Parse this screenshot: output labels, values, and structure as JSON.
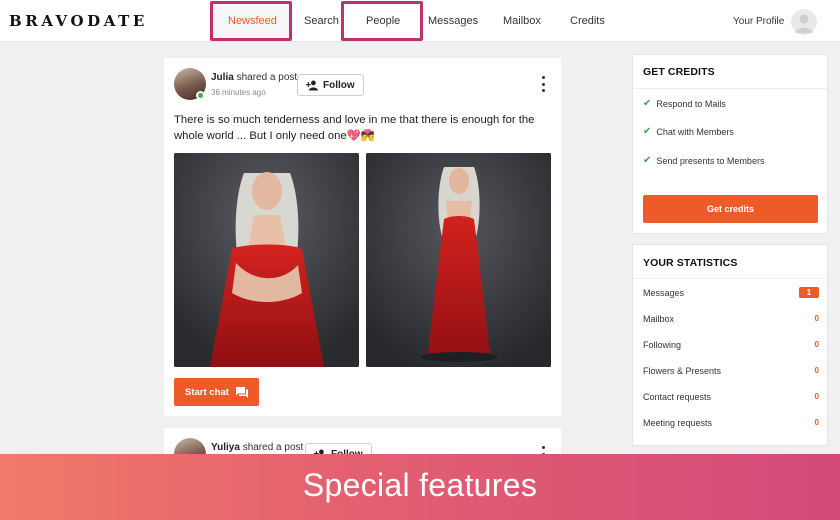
{
  "app": {
    "logo": "BRAVODATE"
  },
  "nav": {
    "items": [
      {
        "label": "Newsfeed",
        "active": true
      },
      {
        "label": "Search"
      },
      {
        "label": "People"
      },
      {
        "label": "Messages"
      },
      {
        "label": "Mailbox"
      },
      {
        "label": "Credits"
      }
    ],
    "profile_label": "Your Profile",
    "highlight_color": "#c0306e"
  },
  "feed": {
    "posts": [
      {
        "author": "Julia",
        "action": "shared a post",
        "time": "36 minutes ago",
        "online": true,
        "follow_label": "Follow",
        "text": "There is so much tenderness and love in me that there is enough for the whole world ... But I only need one💖💏",
        "chat_label": "Start chat"
      },
      {
        "author": "Yuliya",
        "action": "shared a post",
        "follow_label": "Follow"
      }
    ]
  },
  "credits_panel": {
    "title": "GET CREDITS",
    "items": [
      "Respond to Mails",
      "Chat with Members",
      "Send presents to Members"
    ],
    "button_label": "Get credits"
  },
  "stats_panel": {
    "title": "YOUR STATISTICS",
    "rows": [
      {
        "label": "Messages",
        "value": "1"
      },
      {
        "label": "Mailbox",
        "value": "0"
      },
      {
        "label": "Following",
        "value": "0"
      },
      {
        "label": "Flowers & Presents",
        "value": "0"
      },
      {
        "label": "Contact requests",
        "value": "0"
      },
      {
        "label": "Meeting requests",
        "value": "0"
      }
    ]
  },
  "banner": {
    "text": "Special features"
  },
  "colors": {
    "accent": "#ef5a29",
    "online": "#3fb34f",
    "check": "#3fa34d"
  },
  "icons": [
    "follow-icon",
    "chat-icon",
    "more-icon",
    "check-icon",
    "avatar-placeholder-icon"
  ]
}
